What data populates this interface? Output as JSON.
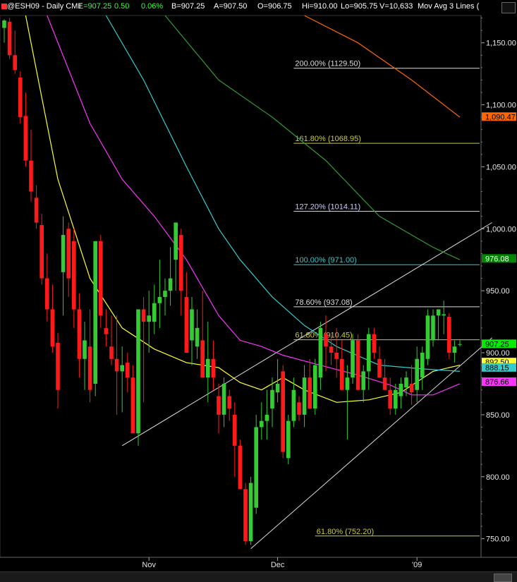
{
  "header": {
    "symbol": "@ESH09 - Daily  CME",
    "last": "L=907.25",
    "change": "0.50",
    "change_pct": "0.06%",
    "bid": "B=907.25",
    "ask": "A=907.50",
    "open": "O=906.75",
    "high": "Hi=910.00",
    "low": "Lo=905.75",
    "volume": "V=10,633",
    "study": "Mov Avg 3 Lines (",
    "colors": {
      "symbol": "#ffffff",
      "change": "#33ff33"
    }
  },
  "chart_data": {
    "type": "candlestick",
    "symbol": "@ESH09",
    "ylim": [
      735,
      1172
    ],
    "y_ticks": [
      750,
      800,
      850,
      900,
      950,
      1000,
      1050,
      1100,
      1150
    ],
    "y_tick_labels": [
      "750.00",
      "800.00",
      "850.00",
      "900.00",
      "950.00",
      "1,000.00",
      "1,050.00",
      "1,100.00",
      "1,150.00"
    ],
    "x_labels": [
      {
        "label": "Nov",
        "index": 27
      },
      {
        "label": "Dec",
        "index": 51
      },
      {
        "label": "'09",
        "index": 77
      }
    ],
    "up_color": "#33cc33",
    "down_color": "#ff1a1a",
    "candles": [
      [
        1162,
        1169,
        1150,
        1168
      ],
      [
        1167,
        1170,
        1137,
        1140
      ],
      [
        1140,
        1160,
        1125,
        1128
      ],
      [
        1122,
        1127,
        1085,
        1090
      ],
      [
        1091,
        1110,
        1050,
        1055
      ],
      [
        1055,
        1080,
        1022,
        1030
      ],
      [
        1025,
        1035,
        1000,
        1005
      ],
      [
        1003,
        1012,
        955,
        960
      ],
      [
        960,
        980,
        925,
        935
      ],
      [
        935,
        955,
        900,
        905
      ],
      [
        908,
        916,
        855,
        870
      ],
      [
        965,
        1010,
        930,
        995
      ],
      [
        1000,
        1005,
        945,
        960
      ],
      [
        990,
        1000,
        920,
        935
      ],
      [
        935,
        948,
        880,
        895
      ],
      [
        895,
        925,
        870,
        910
      ],
      [
        905,
        935,
        860,
        870
      ],
      [
        875,
        990,
        865,
        990
      ],
      [
        990,
        995,
        920,
        930
      ],
      [
        920,
        935,
        905,
        915
      ],
      [
        905,
        930,
        890,
        895
      ],
      [
        895,
        930,
        850,
        885
      ],
      [
        885,
        905,
        852,
        890
      ],
      [
        892,
        900,
        868,
        880
      ],
      [
        880,
        890,
        840,
        835
      ],
      [
        835,
        890,
        825,
        935
      ],
      [
        935,
        945,
        860,
        925
      ],
      [
        925,
        950,
        900,
        930
      ],
      [
        925,
        955,
        915,
        940
      ],
      [
        940,
        975,
        920,
        945
      ],
      [
        945,
        960,
        930,
        950
      ],
      [
        950,
        985,
        938,
        960
      ],
      [
        975,
        1000,
        950,
        1005
      ],
      [
        995,
        1000,
        930,
        950
      ],
      [
        945,
        965,
        920,
        900
      ],
      [
        910,
        945,
        890,
        935
      ],
      [
        905,
        935,
        895,
        920
      ],
      [
        910,
        950,
        890,
        880
      ],
      [
        880,
        925,
        860,
        895
      ],
      [
        895,
        910,
        870,
        880
      ],
      [
        865,
        875,
        835,
        850
      ],
      [
        850,
        880,
        840,
        875
      ],
      [
        865,
        870,
        845,
        855
      ],
      [
        850,
        860,
        800,
        825
      ],
      [
        825,
        830,
        790,
        790
      ],
      [
        790,
        795,
        745,
        748
      ],
      [
        748,
        800,
        745,
        795
      ],
      [
        775,
        850,
        770,
        840
      ],
      [
        840,
        860,
        830,
        845
      ],
      [
        845,
        870,
        830,
        850
      ],
      [
        855,
        880,
        840,
        870
      ],
      [
        868,
        895,
        860,
        875
      ],
      [
        885,
        890,
        815,
        820
      ],
      [
        815,
        850,
        810,
        845
      ],
      [
        845,
        880,
        840,
        870
      ],
      [
        860,
        865,
        845,
        850
      ],
      [
        850,
        890,
        840,
        880
      ],
      [
        880,
        895,
        860,
        855
      ],
      [
        855,
        895,
        850,
        890
      ],
      [
        880,
        925,
        870,
        920
      ],
      [
        915,
        930,
        885,
        905
      ],
      [
        905,
        915,
        890,
        900
      ],
      [
        900,
        920,
        880,
        895
      ],
      [
        895,
        910,
        870,
        870
      ],
      [
        870,
        890,
        830,
        880
      ],
      [
        880,
        915,
        875,
        910
      ],
      [
        910,
        915,
        880,
        870
      ],
      [
        870,
        890,
        860,
        885
      ],
      [
        885,
        920,
        870,
        915
      ],
      [
        915,
        920,
        895,
        900
      ],
      [
        895,
        905,
        880,
        880
      ],
      [
        880,
        895,
        870,
        870
      ],
      [
        870,
        880,
        850,
        855
      ],
      [
        855,
        875,
        850,
        870
      ],
      [
        865,
        880,
        855,
        875
      ],
      [
        872,
        885,
        865,
        880
      ],
      [
        875,
        890,
        858,
        868
      ],
      [
        870,
        905,
        860,
        895
      ],
      [
        880,
        905,
        870,
        900
      ],
      [
        895,
        935,
        890,
        930
      ],
      [
        910,
        935,
        905,
        930
      ],
      [
        930,
        935,
        910,
        935
      ],
      [
        930,
        942,
        915,
        931
      ],
      [
        929,
        932,
        895,
        900
      ],
      [
        900,
        910,
        892,
        905
      ],
      [
        907,
        910,
        905,
        907
      ]
    ],
    "moving_averages": [
      {
        "color": "#ffff33",
        "points": [
          [
            4,
            1172
          ],
          [
            10,
            1040
          ],
          [
            16,
            960
          ],
          [
            22,
            920
          ],
          [
            28,
            903
          ],
          [
            34,
            892
          ],
          [
            40,
            888
          ],
          [
            44,
            876
          ],
          [
            48,
            870
          ],
          [
            52,
            880
          ],
          [
            56,
            870
          ],
          [
            62,
            860
          ],
          [
            68,
            862
          ],
          [
            74,
            868
          ],
          [
            80,
            885
          ],
          [
            85,
            890
          ]
        ]
      },
      {
        "color": "#ff33ff",
        "points": [
          [
            8,
            1172
          ],
          [
            16,
            1085
          ],
          [
            22,
            1040
          ],
          [
            28,
            1010
          ],
          [
            34,
            975
          ],
          [
            40,
            930
          ],
          [
            44,
            910
          ],
          [
            48,
            905
          ],
          [
            52,
            898
          ],
          [
            58,
            891
          ],
          [
            66,
            882
          ],
          [
            72,
            874
          ],
          [
            76,
            866
          ],
          [
            80,
            866
          ],
          [
            85,
            875
          ]
        ]
      },
      {
        "color": "#33cccc",
        "points": [
          [
            19,
            1172
          ],
          [
            26,
            1120
          ],
          [
            34,
            1050
          ],
          [
            40,
            1000
          ],
          [
            44,
            975
          ],
          [
            50,
            945
          ],
          [
            56,
            922
          ],
          [
            62,
            905
          ],
          [
            70,
            890
          ],
          [
            78,
            887
          ],
          [
            85,
            885
          ]
        ]
      },
      {
        "color": "#339933",
        "points": [
          [
            30,
            1172
          ],
          [
            40,
            1120
          ],
          [
            50,
            1090
          ],
          [
            60,
            1055
          ],
          [
            70,
            1010
          ],
          [
            80,
            985
          ],
          [
            85,
            975
          ]
        ]
      },
      {
        "color": "#ff6600",
        "points": [
          [
            56,
            1172
          ],
          [
            66,
            1150
          ],
          [
            76,
            1120
          ],
          [
            85,
            1090
          ]
        ]
      }
    ],
    "trendlines": [
      {
        "from": [
          22,
          825
        ],
        "to": [
          91,
          1005
        ]
      },
      {
        "from": [
          46,
          742
        ],
        "to": [
          91,
          912
        ]
      }
    ],
    "fib_levels": [
      {
        "label": "200.00% (1129.50)",
        "value": 1129.5,
        "color": "#dddddd",
        "from": 54
      },
      {
        "label": "161.80% (1068.95)",
        "value": 1068.95,
        "color": "#cccc33",
        "from": 54
      },
      {
        "label": "127.20% (1014.11)",
        "value": 1014.11,
        "color": "#ccccff",
        "from": 54
      },
      {
        "label": "100.00% (971.00)",
        "value": 971.0,
        "color": "#33cccc",
        "from": 54
      },
      {
        "label": "78.60% (937.08)",
        "value": 937.08,
        "color": "#dddddd",
        "from": 54
      },
      {
        "label": "61.80% (910.45)",
        "value": 910.45,
        "color": "#cccc33",
        "from": 54
      },
      {
        "label": "61.80% (752.20)",
        "value": 752.2,
        "color": "#cccc33",
        "from": 58
      }
    ],
    "price_badges": [
      {
        "label": "1,090.47",
        "value": 1090.47,
        "bg": "#ff6600",
        "fg": "#000000"
      },
      {
        "label": "976.08",
        "value": 976.08,
        "bg": "#008800",
        "fg": "#ffffff"
      },
      {
        "label": "907.25",
        "value": 907.25,
        "bg": "#00ee00",
        "fg": "#000000"
      },
      {
        "label": "892.50",
        "value": 892.5,
        "bg": "#ffff33",
        "fg": "#000000"
      },
      {
        "label": "888.15",
        "value": 888.15,
        "bg": "#33cccc",
        "fg": "#000000"
      },
      {
        "label": "876.66",
        "value": 876.66,
        "bg": "#ff33ff",
        "fg": "#000000"
      }
    ]
  }
}
